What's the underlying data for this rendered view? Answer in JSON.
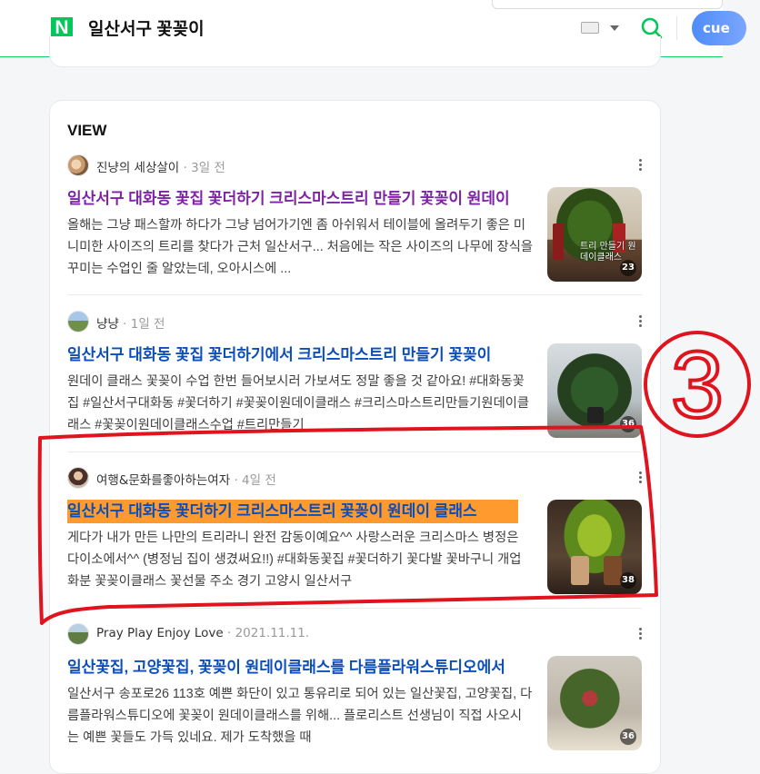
{
  "header": {
    "logo": "N",
    "query": "일산서구 꽃꽂이",
    "cue_label": "cue"
  },
  "view": {
    "title": "VIEW",
    "posts": [
      {
        "author": "진냥의 세상살이",
        "date": "3일 전",
        "title": "일산서구 대화동 꽃집 꽃더하기 크리스마스트리 만들기 꽃꽂이 원데이",
        "description": "올해는 그냥 패스할까 하다가 그냥 넘어가기엔 좀 아쉬워서 테이블에 올려두기 좋은 미니미한 사이즈의 트리를 찾다가 근처 일산서구... 처음에는 작은 사이즈의 나무에 장식을 꾸미는 수업인 줄 알았는데, 오아시스에 ...",
        "thumb_caption": "트리 만들기 원데이클래스",
        "thumb_count": "23"
      },
      {
        "author": "냥냥",
        "date": "1일 전",
        "title": "일산서구 대화동 꽃집 꽃더하기에서 크리스마스트리 만들기 꽃꽂이",
        "description": "원데이 클래스 꽃꽂이 수업 한번 들어보시러 가보셔도 정말 좋을 것 같아요! #대화동꽃집 #일산서구대화동 #꽃더하기 #꽃꽂이원데이클래스 #크리스마스트리만들기원데이클래스 #꽃꽂이원데이클래스수업 #트리만들기",
        "thumb_count": "36"
      },
      {
        "author": "여행&문화를좋아하는여자",
        "date": "4일 전",
        "title": "일산서구 대화동 꽃더하기 크리스마스트리 꽃꽂이 원데이 클래스",
        "description": "게다가 내가 만든 나만의 트리라니 완전 감동이예요^^ 사랑스러운 크리스마스 병정은 다이소에서^^ (병정님 집이 생겼써요!!) #대화동꽃집 #꽃더하기 꽃다발 꽃바구니 개업화분 꽃꽂이클래스 꽃선물 주소 경기 고양시 일산서구",
        "thumb_count": "38"
      },
      {
        "author": "Pray Play Enjoy Love",
        "date": "2021.11.11.",
        "title": "일산꽃집, 고양꽃집, 꽃꽂이 원데이클래스를 다름플라워스튜디오에서",
        "description": "일산서구 송포로26 113호 예쁜 화단이 있고 통유리로 되어 있는 일산꽃집, 고양꽃집, 다름플라워스튜디오에 꽃꽂이 원데이클래스를 위해... 플로리스트 선생님이 직접 사오시는 예쁜 꽃들도 가득 있네요. 제가 도착했을 때",
        "thumb_count": "36"
      }
    ]
  },
  "annotation": {
    "label": "3"
  },
  "colors": {
    "brand": "#03c75a",
    "link": "#0b4eb8",
    "visited_link": "#7e23a6",
    "highlight": "#ff9a2e",
    "annotation_red": "#e0141e"
  }
}
